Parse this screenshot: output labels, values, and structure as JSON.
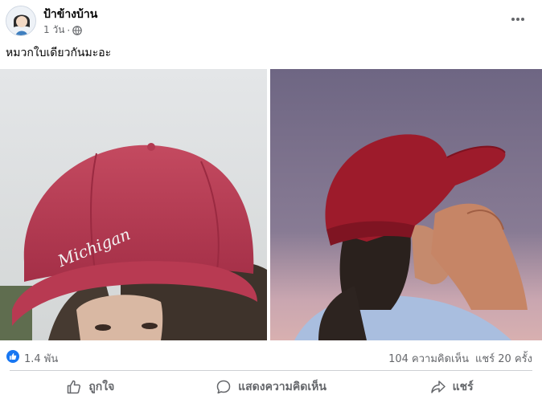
{
  "post": {
    "author": "ป้าข้างบ้าน",
    "time": "1 วัน",
    "separator": "·",
    "caption": "หมวกใบเดียวกันมะอะ",
    "cap_text": "Michigan"
  },
  "stats": {
    "reactions": "1.4 พัน",
    "comments": "104 ความคิดเห็น",
    "shares": "แชร์ 20 ครั้ง"
  },
  "actions": {
    "like": "ถูกใจ",
    "comment": "แสดงความคิดเห็น",
    "share": "แชร์"
  },
  "colors": {
    "brand": "#1877f2",
    "secondary_text": "#65676b",
    "cap_red": "#b8364f"
  }
}
